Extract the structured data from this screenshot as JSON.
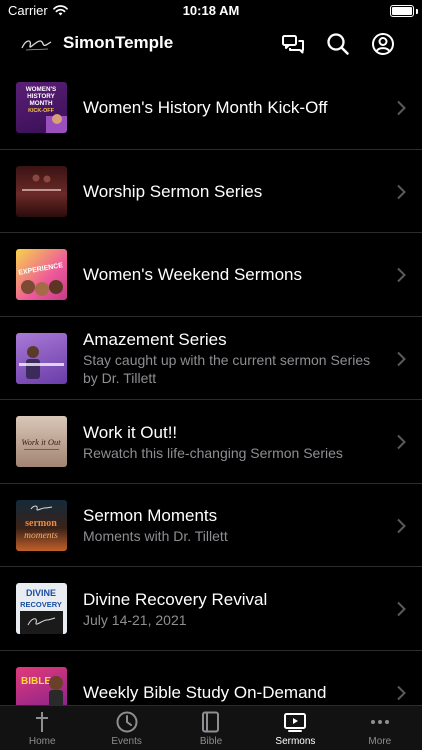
{
  "status_bar": {
    "carrier": "Carrier",
    "time": "10:18 AM"
  },
  "header": {
    "logo_text": "Simon",
    "title": "SimonTemple"
  },
  "list": [
    {
      "title": "Women's History Month Kick-Off",
      "subtitle": "",
      "thumb_lines": [
        "WOMEN'S",
        "HISTORY",
        "MONTH",
        "KICK-OFF"
      ]
    },
    {
      "title": "Worship Sermon Series",
      "subtitle": ""
    },
    {
      "title": "Women's Weekend Sermons",
      "subtitle": "",
      "thumb_lines": [
        "EXPERIENCE"
      ]
    },
    {
      "title": "Amazement Series",
      "subtitle": "Stay caught up with the current sermon Series by Dr. Tillett"
    },
    {
      "title": "Work it Out!!",
      "subtitle": "Rewatch this life-changing Sermon Series",
      "thumb_lines": [
        "Work it Out"
      ]
    },
    {
      "title": "Sermon Moments",
      "subtitle": "Moments with Dr. Tillett",
      "thumb_lines": [
        "sermon",
        "moments"
      ]
    },
    {
      "title": "Divine Recovery Revival",
      "subtitle": "July 14-21, 2021",
      "thumb_lines": [
        "DIVINE",
        "RECOVERY"
      ]
    },
    {
      "title": "Weekly Bible Study On-Demand",
      "subtitle": "",
      "thumb_lines": [
        "BIBLE"
      ]
    }
  ],
  "tabs": [
    {
      "label": "Home",
      "icon": "cross-icon",
      "active": false
    },
    {
      "label": "Events",
      "icon": "clock-icon",
      "active": false
    },
    {
      "label": "Bible",
      "icon": "book-icon",
      "active": false
    },
    {
      "label": "Sermons",
      "icon": "play-screen-icon",
      "active": true
    },
    {
      "label": "More",
      "icon": "ellipsis-icon",
      "active": false
    }
  ],
  "colors": {
    "background": "#000000",
    "separator": "#2c2c2e",
    "secondary_text": "#8e8e93",
    "tab_bar": "#121212"
  }
}
